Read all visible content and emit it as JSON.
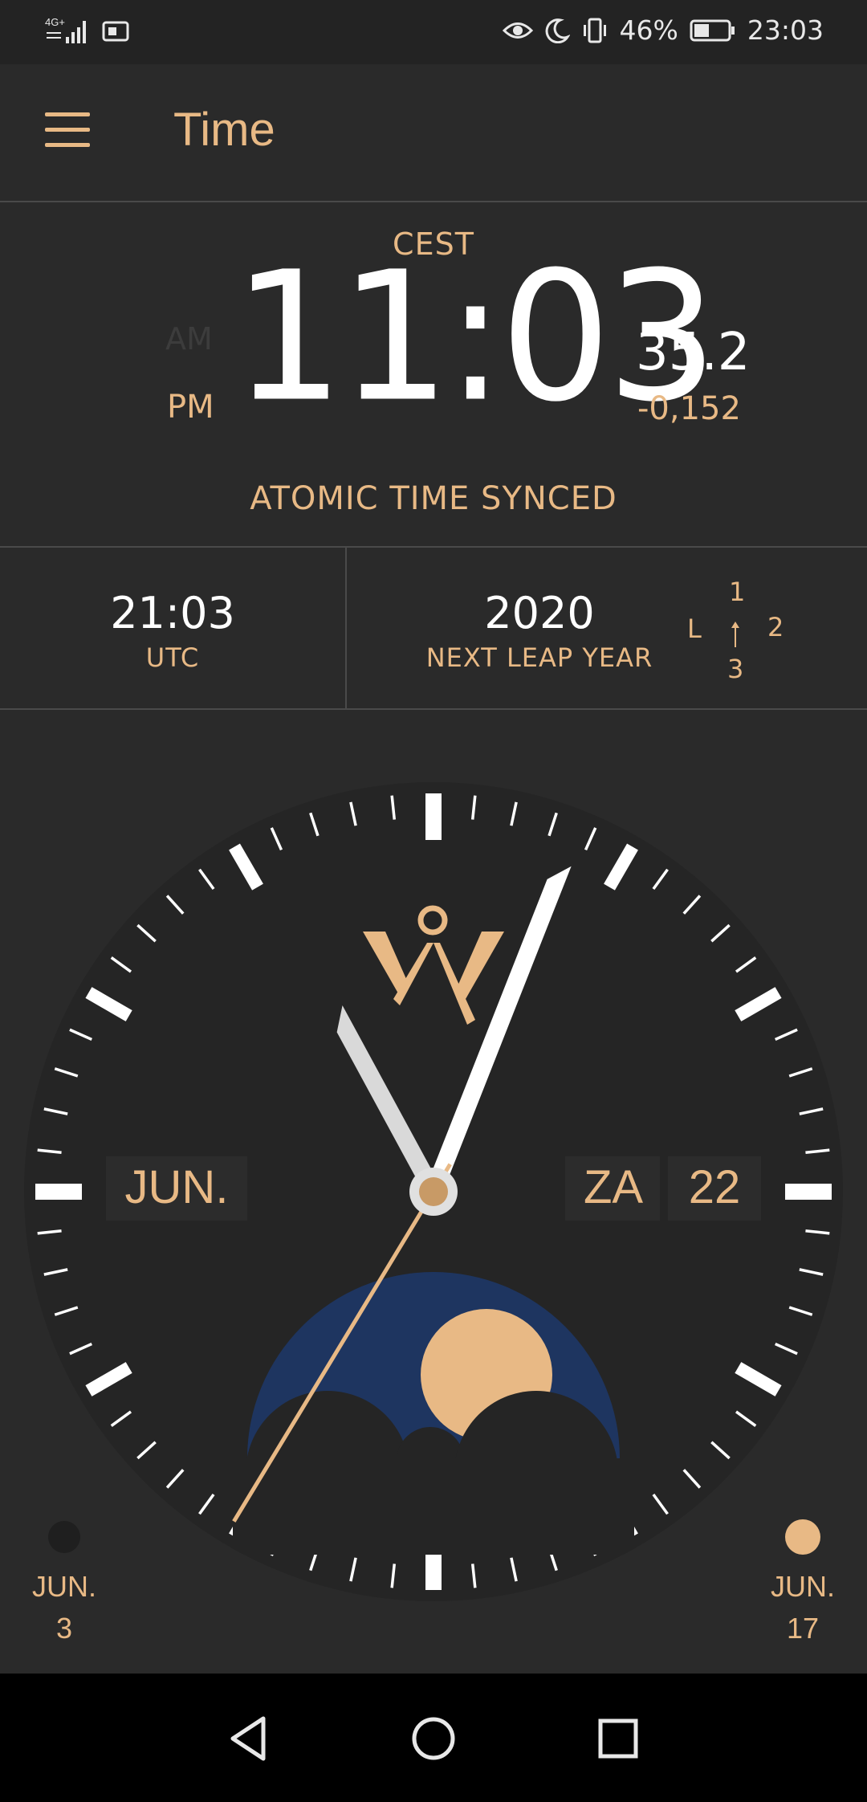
{
  "status_bar": {
    "network": "4G+",
    "battery_percent": "46%",
    "battery_level": 0.46,
    "clock": "23:03",
    "icons": [
      "signal-icon",
      "notification-icon",
      "eye-icon",
      "moon-icon",
      "vibrate-icon",
      "battery-icon"
    ]
  },
  "app_bar": {
    "title": "Time",
    "menu_icon": "hamburger-menu-icon"
  },
  "main_time": {
    "timezone": "CEST",
    "am_label": "AM",
    "pm_label": "PM",
    "time": "11:03",
    "seconds": "35.2",
    "offset": "-0,152",
    "sync_status": "ATOMIC TIME SYNCED"
  },
  "info_row": {
    "utc_time": "21:03",
    "utc_label": "UTC",
    "leap_year": "2020",
    "leap_label": "NEXT LEAP YEAR",
    "leap_indicator": {
      "top": "1",
      "right": "2",
      "bottom": "3",
      "left": "L"
    }
  },
  "clock": {
    "hour": 11,
    "minute": 3,
    "second": 35.2,
    "month_window": "JUN.",
    "day_window": "ZA",
    "date_window": "22",
    "moon_phase": "waxing",
    "colors": {
      "accent": "#e8b985",
      "moon_sky": "#1e3560",
      "dial": "#252525",
      "window": "#2c2c2c"
    }
  },
  "moon_dates": {
    "left": {
      "month": "JUN.",
      "day": "3",
      "phase": "new-moon"
    },
    "right": {
      "month": "JUN.",
      "day": "17",
      "phase": "full-moon"
    }
  },
  "nav_bar": {
    "back": "back-icon",
    "home": "home-icon",
    "recents": "recents-icon"
  }
}
